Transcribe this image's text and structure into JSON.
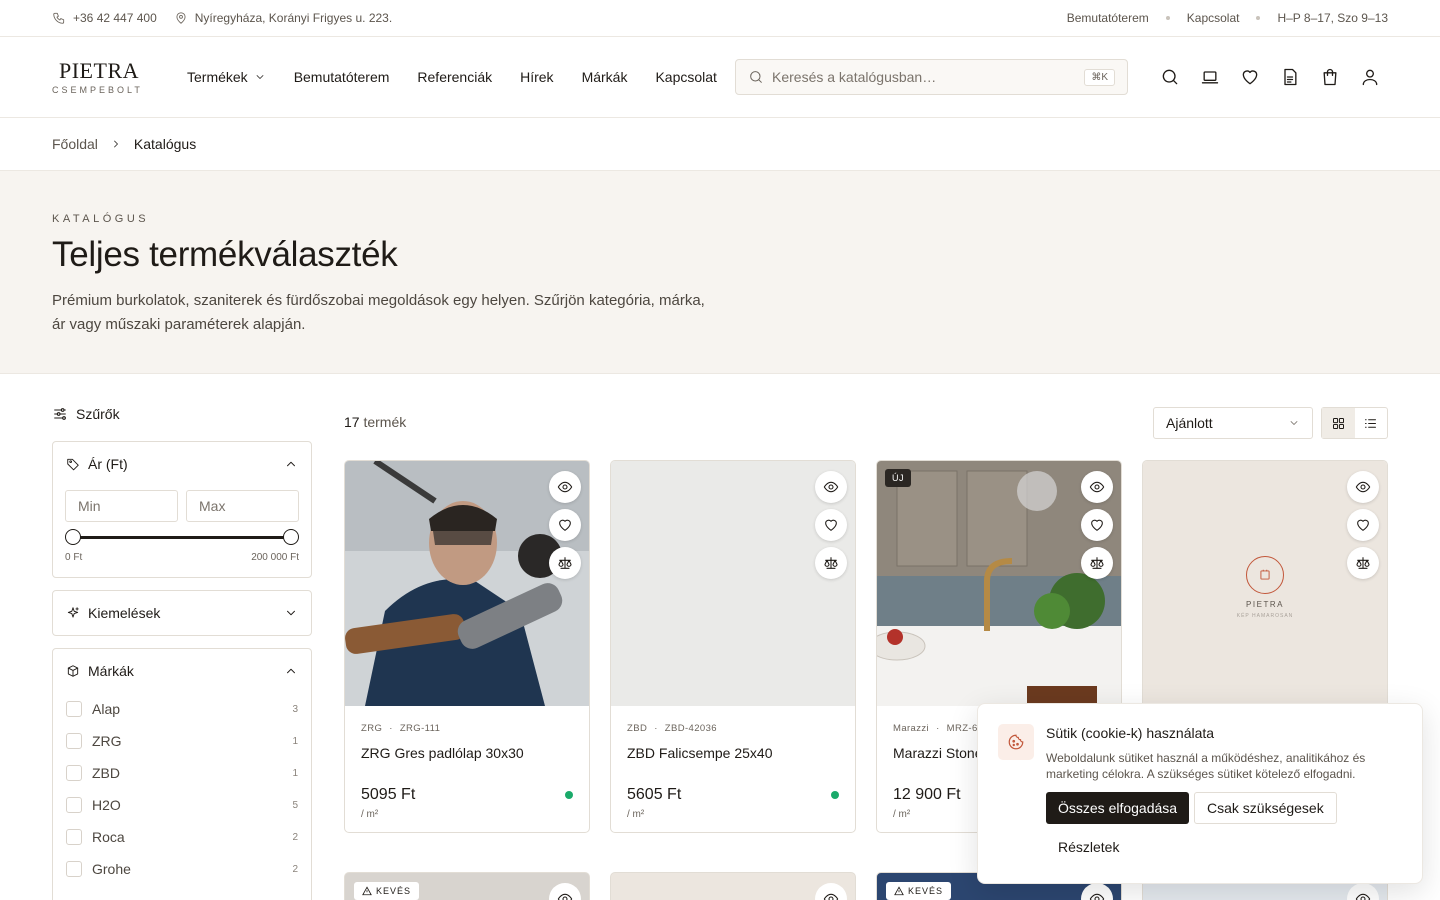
{
  "topbar": {
    "phone": "+36 42 447 400",
    "address": "Nyíregyháza, Korányi Frigyes u. 223.",
    "links": [
      "Bemutatóterem",
      "Kapcsolat"
    ],
    "hours": "H–P 8–17, Szo 9–13"
  },
  "header": {
    "logo_main": "PIETRA",
    "logo_sub": "CSEMPEBOLT",
    "nav": [
      "Termékek",
      "Bemutatóterem",
      "Referenciák",
      "Hírek",
      "Márkák",
      "Kapcsolat"
    ],
    "search_placeholder": "Keresés a katalógusban…",
    "search_shortcut": "⌘K",
    "icons": [
      "search-icon",
      "showroom-icon",
      "heart-icon",
      "document-icon",
      "bag-icon",
      "user-icon"
    ]
  },
  "breadcrumb": {
    "home": "Főoldal",
    "current": "Katalógus"
  },
  "hero": {
    "eyebrow": "KATALÓGUS",
    "title": "Teljes termékválaszték",
    "description": "Prémium burkolatok, szaniterek és fürdőszobai megoldások egy helyen. Szűrjön kategória, márka, ár vagy műszaki paraméterek alapján."
  },
  "filters": {
    "title": "Szűrők",
    "price": {
      "label": "Ár (Ft)",
      "min_placeholder": "Min",
      "max_placeholder": "Max",
      "range_min_label": "0 Ft",
      "range_max_label": "200 000 Ft"
    },
    "highlights": {
      "label": "Kiemelések"
    },
    "brands": {
      "label": "Márkák",
      "items": [
        {
          "name": "Alap",
          "count": "3"
        },
        {
          "name": "ZRG",
          "count": "1"
        },
        {
          "name": "ZBD",
          "count": "1"
        },
        {
          "name": "H2O",
          "count": "5"
        },
        {
          "name": "Roca",
          "count": "2"
        },
        {
          "name": "Grohe",
          "count": "2"
        }
      ]
    }
  },
  "results": {
    "count_number": "17",
    "count_label": "termék",
    "sort_selected": "Ajánlott"
  },
  "products": [
    {
      "brand": "ZRG",
      "sku": "ZRG-111",
      "name": "ZRG Gres padlólap 30x30",
      "price": "5095 Ft",
      "unit": "/ m²",
      "badge": ""
    },
    {
      "brand": "ZBD",
      "sku": "ZBD-42036",
      "name": "ZBD Falicsempe 25x40",
      "price": "5605 Ft",
      "unit": "/ m²",
      "badge": ""
    },
    {
      "brand": "Marazzi",
      "sku": "MRZ-6",
      "name": "Marazzi Stone",
      "price": "12 900 Ft",
      "unit": "/ m²",
      "badge": "ÚJ"
    },
    {
      "brand": "",
      "sku": "",
      "name": "",
      "price": "",
      "unit": "",
      "badge": "",
      "placeholder_logo": "PIETRA",
      "placeholder_text": "KÉP HAMAROSAN"
    }
  ],
  "second_row_badges": [
    "KEVÉS",
    "",
    "KEVÉS",
    ""
  ],
  "cookie": {
    "title": "Sütik (cookie-k) használata",
    "text": "Weboldalunk sütiket használ a működéshez, analitikához és marketing célokra. A szükséges sütiket kötelező elfogadni.",
    "accept_all": "Összes elfogadása",
    "necessary_only": "Csak szükségesek",
    "details": "Részletek"
  },
  "colors": {
    "accent": "#1f1b17",
    "hero_bg": "#f7f4f0",
    "in_stock": "#1aaa6a",
    "cookie_icon": "#c2573a"
  }
}
